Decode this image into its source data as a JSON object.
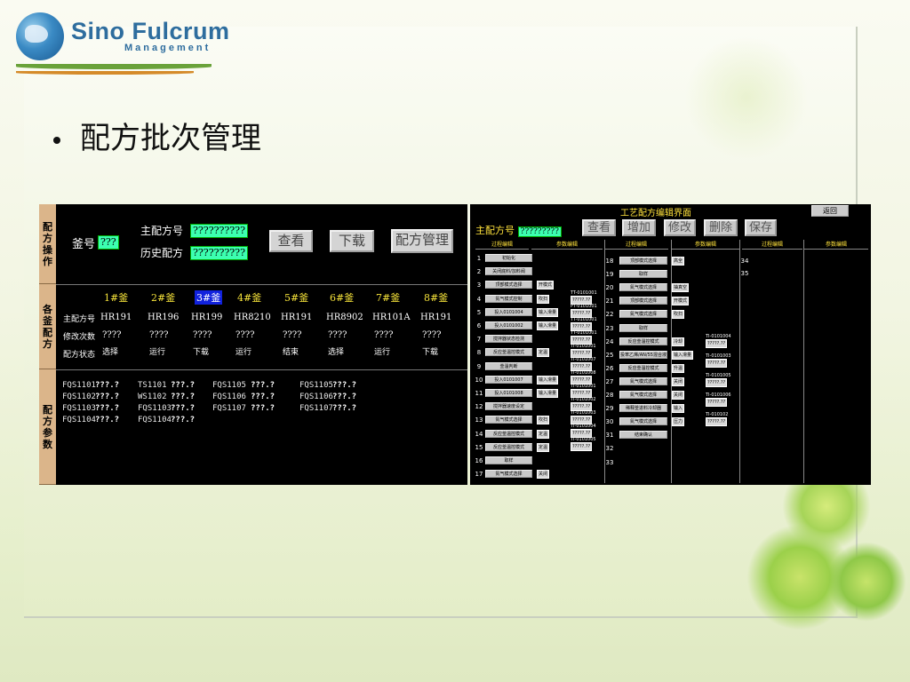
{
  "logo": {
    "name": "Sino Fulcrum",
    "sub": "Management"
  },
  "slide_title": "配方批次管理",
  "left": {
    "side_labels": {
      "ops": "配方操作",
      "kettles": "各釜配方",
      "params": "配方参数"
    },
    "kettle_no_label": "釜号",
    "kettle_no_value": "???",
    "main_recipe_label": "主配方号",
    "main_recipe_value": "??????????",
    "history_recipe_label": "历史配方",
    "history_recipe_value": "??????????",
    "buttons": {
      "view": "查看",
      "download": "下载",
      "manage": "配方管理"
    },
    "row_labels": [
      "主配方号",
      "修改次数",
      "配方状态"
    ],
    "kettles": [
      {
        "name": "1#釜",
        "recipe": "HR191",
        "mods": "????",
        "status": "选择"
      },
      {
        "name": "2#釜",
        "recipe": "HR196",
        "mods": "????",
        "status": "运行"
      },
      {
        "name": "3#釜",
        "recipe": "HR199",
        "mods": "????",
        "status": "下载"
      },
      {
        "name": "4#釜",
        "recipe": "HR8210",
        "mods": "????",
        "status": "运行"
      },
      {
        "name": "5#釜",
        "recipe": "HR191",
        "mods": "????",
        "status": "结束"
      },
      {
        "name": "6#釜",
        "recipe": "HR8902",
        "mods": "????",
        "status": "选择"
      },
      {
        "name": "7#釜",
        "recipe": "HR101A",
        "mods": "????",
        "status": "运行"
      },
      {
        "name": "8#釜",
        "recipe": "HR191",
        "mods": "????",
        "status": "下载"
      }
    ],
    "selected_kettle_index": 2,
    "params": [
      [
        {
          "n": "FQS1101",
          "v": "???.?"
        },
        {
          "n": "FQS1102",
          "v": "???.?"
        },
        {
          "n": "FQS1103",
          "v": "???.?"
        },
        {
          "n": "FQS1104",
          "v": "???.?"
        }
      ],
      [
        {
          "n": "TS1101",
          "v": "???.?"
        },
        {
          "n": "WS1102",
          "v": "???.?"
        },
        {
          "n": "FQS1103",
          "v": "???.?"
        },
        {
          "n": "FQS1104",
          "v": "???.?"
        }
      ],
      [
        {
          "n": "FQS1105",
          "v": "???.?"
        },
        {
          "n": "FQS1106",
          "v": "???.?"
        },
        {
          "n": "FQS1107",
          "v": "???.?"
        }
      ],
      [
        {
          "n": "FQS1105",
          "v": "???.?"
        },
        {
          "n": "FQS1106",
          "v": "???.?"
        },
        {
          "n": "FQS1107",
          "v": "???.?"
        }
      ]
    ]
  },
  "right": {
    "title": "工艺配方编辑界面",
    "back": "返回",
    "main_recipe_label": "主配方号",
    "main_recipe_value": "?????????",
    "buttons": [
      "查看",
      "增加",
      "修改",
      "删除",
      "保存"
    ],
    "headers": [
      "过程编辑",
      "参数编辑",
      "过程编辑",
      "参数编辑",
      "过程编辑",
      "参数编辑"
    ],
    "col1": [
      {
        "no": "1",
        "step": "初始化"
      },
      {
        "no": "2",
        "step": "关闭底料/加料阀"
      },
      {
        "no": "3",
        "step": "顶部模式选择",
        "opt": "开模式"
      },
      {
        "no": "4",
        "step": "氮气模式控制",
        "opt": "吹扫"
      },
      {
        "no": "5",
        "step": "投入0101004",
        "opt": "输入滑量"
      },
      {
        "no": "6",
        "step": "投入0101002",
        "opt": "输入滑量"
      },
      {
        "no": "7",
        "step": "搅拌器状态检测"
      },
      {
        "no": "8",
        "step": "反应釜温控模式",
        "opt": "定温"
      },
      {
        "no": "9",
        "step": "釜温判断"
      },
      {
        "no": "10",
        "step": "投入0101007",
        "opt": "输入滑量"
      },
      {
        "no": "11",
        "step": "投入0101008",
        "opt": "输入滑量"
      },
      {
        "no": "12",
        "step": "搅拌器速度设定"
      },
      {
        "no": "13",
        "step": "氮气模式选择",
        "opt": "吹扫"
      },
      {
        "no": "14",
        "step": "反应釜温控模式",
        "opt": "定温"
      },
      {
        "no": "15",
        "step": "反应釜温控模式",
        "opt": "定温"
      },
      {
        "no": "16",
        "step": "取样"
      },
      {
        "no": "17",
        "step": "氮气模式选择",
        "opt": "关闭"
      }
    ],
    "col1_params": [
      {
        "tag": "TT-0101001",
        "val": "?????.??"
      },
      {
        "tag": "PT-0101001",
        "val": "?????.??"
      },
      {
        "tag": "TT-0101001",
        "val": "?????.??"
      },
      {
        "tag": "TT-0101001",
        "val": "?????.??"
      },
      {
        "tag": "TI-0101001",
        "val": "?????.??"
      },
      {
        "tag": "TI-0101007",
        "val": "?????.??"
      },
      {
        "tag": "TI-0101008",
        "val": "?????.??"
      },
      {
        "tag": "TI-0101001",
        "val": "?????.??"
      },
      {
        "tag": "TI-0101002",
        "val": "?????.??"
      },
      {
        "tag": "TI-0101003",
        "val": "?????.??"
      },
      {
        "tag": "TI-0101004",
        "val": "?????.??"
      },
      {
        "tag": "TI-0101005",
        "val": "?????.??"
      }
    ],
    "col2": [
      {
        "no": "18",
        "step": "顶部模式选择",
        "opt": "高全"
      },
      {
        "no": "19",
        "step": "取样"
      },
      {
        "no": "20",
        "step": "氮气模式选择",
        "opt": "抽真空"
      },
      {
        "no": "21",
        "step": "顶部模式选择",
        "opt": "开模式"
      },
      {
        "no": "22",
        "step": "氮气模式选择",
        "opt": "吹扫"
      },
      {
        "no": "23",
        "step": "取样"
      },
      {
        "no": "24",
        "step": "反应釜温控模式",
        "opt": "冷却"
      },
      {
        "no": "25",
        "step": "投苯乙烯/AN/55混合液",
        "opt": "输入滑量"
      },
      {
        "no": "26",
        "step": "反应釜温控模式",
        "opt": "升温"
      },
      {
        "no": "27",
        "step": "氮气模式选择",
        "opt": "关闭"
      },
      {
        "no": "28",
        "step": "氮气模式选择",
        "opt": "关闭"
      },
      {
        "no": "29",
        "step": "稀释釜进料冷却器",
        "opt": "输入"
      },
      {
        "no": "30",
        "step": "氮气模式选择",
        "opt": "压力"
      },
      {
        "no": "31",
        "step": "结束确认"
      },
      {
        "no": "32",
        "step": ""
      },
      {
        "no": "33",
        "step": ""
      }
    ],
    "col2_params": [
      {
        "tag": "TI-0101004",
        "val": "?????.??"
      },
      {
        "tag": "TI-0101003",
        "val": "?????.??"
      },
      {
        "tag": "TI-0101005",
        "val": "?????.??"
      },
      {
        "tag": "TI-0101006",
        "val": "?????.??"
      },
      {
        "tag": "TI-010102",
        "val": "?????.??"
      }
    ],
    "col3": [
      {
        "no": "34"
      },
      {
        "no": "35"
      }
    ]
  }
}
